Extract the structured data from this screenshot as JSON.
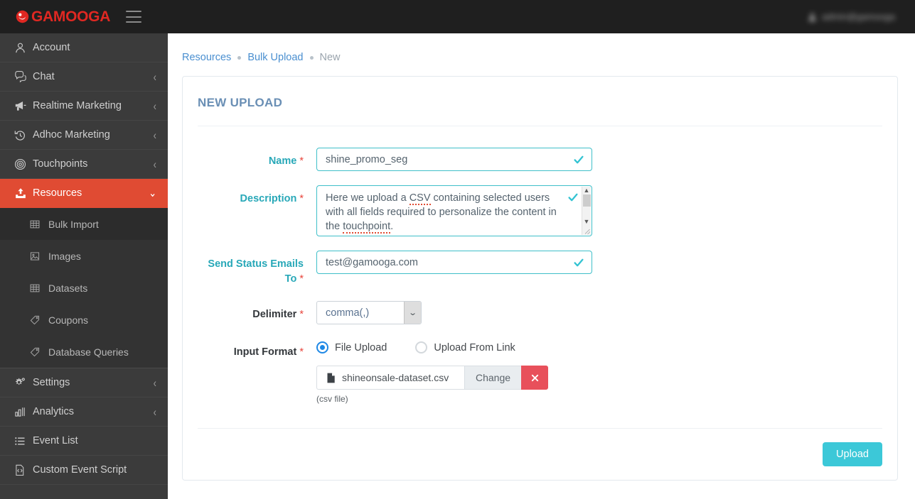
{
  "topbar": {
    "logo_text": "GAMOOGA",
    "logo_icon": "gamooga-mark-icon",
    "menu_icon": "hamburger-menu-icon",
    "user_icon": "user-avatar-icon",
    "user_name": "admin@gamooga",
    "brand_color": "#e02822",
    "background": "#1f1f1f"
  },
  "sidebar": {
    "background": "#3b3b3b",
    "active_color": "#e04b33",
    "items": [
      {
        "label": "Account",
        "icon": "user-icon",
        "caret": "",
        "active": false
      },
      {
        "label": "Chat",
        "icon": "chat-icon",
        "caret": "‹",
        "active": false
      },
      {
        "label": "Realtime Marketing",
        "icon": "megaphone-icon",
        "caret": "‹",
        "active": false
      },
      {
        "label": "Adhoc Marketing",
        "icon": "history-icon",
        "caret": "‹",
        "active": false
      },
      {
        "label": "Touchpoints",
        "icon": "target-icon",
        "caret": "‹",
        "active": false
      },
      {
        "label": "Resources",
        "icon": "upload-icon",
        "caret": "⌄",
        "active": true
      }
    ],
    "sub_items": [
      {
        "label": "Bulk Import",
        "icon": "table-icon",
        "selected": true
      },
      {
        "label": "Images",
        "icon": "image-icon",
        "selected": false
      },
      {
        "label": "Datasets",
        "icon": "table-icon",
        "selected": false
      },
      {
        "label": "Coupons",
        "icon": "tag-icon",
        "selected": false
      },
      {
        "label": "Database Queries",
        "icon": "tag-icon",
        "selected": false
      }
    ],
    "items_bottom": [
      {
        "label": "Settings",
        "icon": "gears-icon",
        "caret": "‹"
      },
      {
        "label": "Analytics",
        "icon": "bar-chart-icon",
        "caret": "‹"
      },
      {
        "label": "Event List",
        "icon": "list-icon",
        "caret": ""
      },
      {
        "label": "Custom Event Script",
        "icon": "code-file-icon",
        "caret": ""
      }
    ]
  },
  "breadcrumb": {
    "items": [
      "Resources",
      "Bulk Upload",
      "New"
    ]
  },
  "card": {
    "title": "NEW UPLOAD",
    "fields": {
      "name": {
        "label": "Name",
        "required": "*",
        "value": "shine_promo_seg",
        "valid_icon": "check-icon"
      },
      "description": {
        "label": "Description",
        "required": "*",
        "line1_a": "Here we upload a ",
        "line1_b": "CSV",
        "line1_c": " containing selected users",
        "line2": "with all fields required to personalize the content",
        "line3_a": "in the ",
        "line3_b": "touchpoint",
        "line3_c": ".",
        "full_value": "Here we upload a CSV containing selected users with all fields required to personalize the content in the touchpoint.",
        "valid_icon": "check-icon",
        "scroll_up_icon": "chevron-up-icon",
        "scroll_down_icon": "chevron-down-icon"
      },
      "email": {
        "label_line1": "Send Status Emails",
        "label_line2": "To",
        "required": "*",
        "value": "test@gamooga.com",
        "valid_icon": "check-icon"
      },
      "delimiter": {
        "label": "Delimiter",
        "required": "*",
        "value": "comma(,)",
        "dropdown_icon": "chevron-down-icon"
      },
      "input_format": {
        "label": "Input Format",
        "required": "*",
        "options": [
          {
            "label": "File Upload",
            "selected": true
          },
          {
            "label": "Upload From Link",
            "selected": false
          }
        ],
        "selected_color": "#1e88e5"
      },
      "file": {
        "file_icon": "file-icon",
        "file_name": "shineonsale-dataset.csv",
        "change_label": "Change",
        "delete_icon": "close-x-icon",
        "delete_color": "#e8505b",
        "hint": "(csv file)"
      }
    },
    "submit_label": "Upload",
    "submit_color": "#3cc8d8"
  }
}
